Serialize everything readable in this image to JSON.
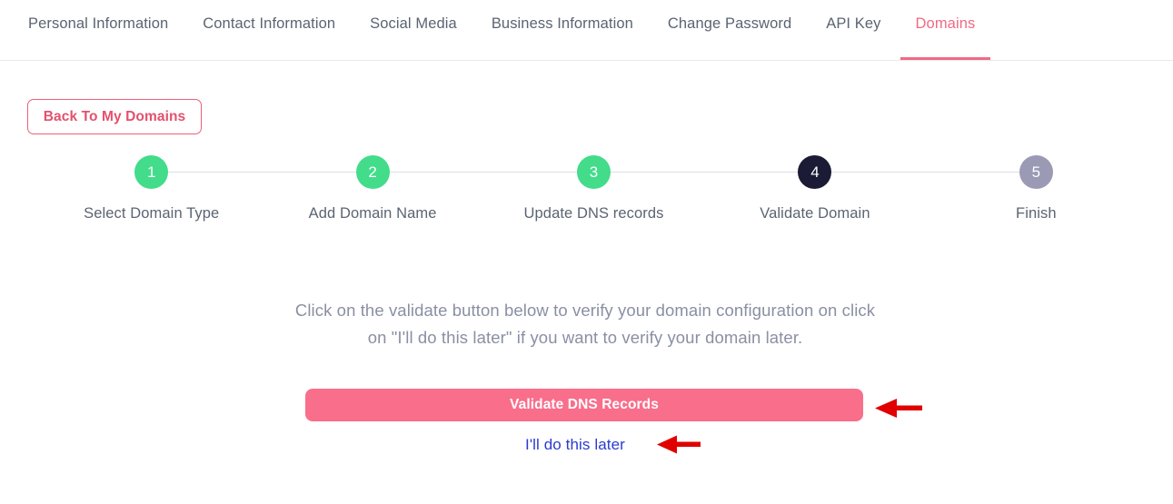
{
  "nav": {
    "tabs": [
      {
        "label": "Personal Information",
        "active": false
      },
      {
        "label": "Contact Information",
        "active": false
      },
      {
        "label": "Social Media",
        "active": false
      },
      {
        "label": "Business Information",
        "active": false
      },
      {
        "label": "Change Password",
        "active": false
      },
      {
        "label": "API Key",
        "active": false
      },
      {
        "label": "Domains",
        "active": true
      }
    ]
  },
  "back_button": {
    "label": "Back To My Domains"
  },
  "stepper": {
    "steps": [
      {
        "number": "1",
        "label": "Select Domain Type",
        "state": "done"
      },
      {
        "number": "2",
        "label": "Add Domain Name",
        "state": "done"
      },
      {
        "number": "3",
        "label": "Update DNS records",
        "state": "done"
      },
      {
        "number": "4",
        "label": "Validate Domain",
        "state": "current"
      },
      {
        "number": "5",
        "label": "Finish",
        "state": "todo"
      }
    ]
  },
  "main": {
    "instruction": "Click on the validate button below to verify your domain configuration on click on \"I'll do this later\" if you want to verify your domain later.",
    "validate_button_label": "Validate DNS Records",
    "later_link_label": "I'll do this later"
  },
  "annotations": {
    "arrow_color": "#e00000",
    "arrow_1_name": "arrow-pointing-to-validate-button",
    "arrow_2_name": "arrow-pointing-to-later-link"
  },
  "colors": {
    "accent_pink": "#ef6a85",
    "button_pink": "#f96e8b",
    "step_done_green": "#42dc8a",
    "step_current_navy": "#1b1b35",
    "step_todo_gray": "#9a9ab5",
    "link_blue": "#2a3bd0",
    "text_gray": "#5b6472"
  }
}
